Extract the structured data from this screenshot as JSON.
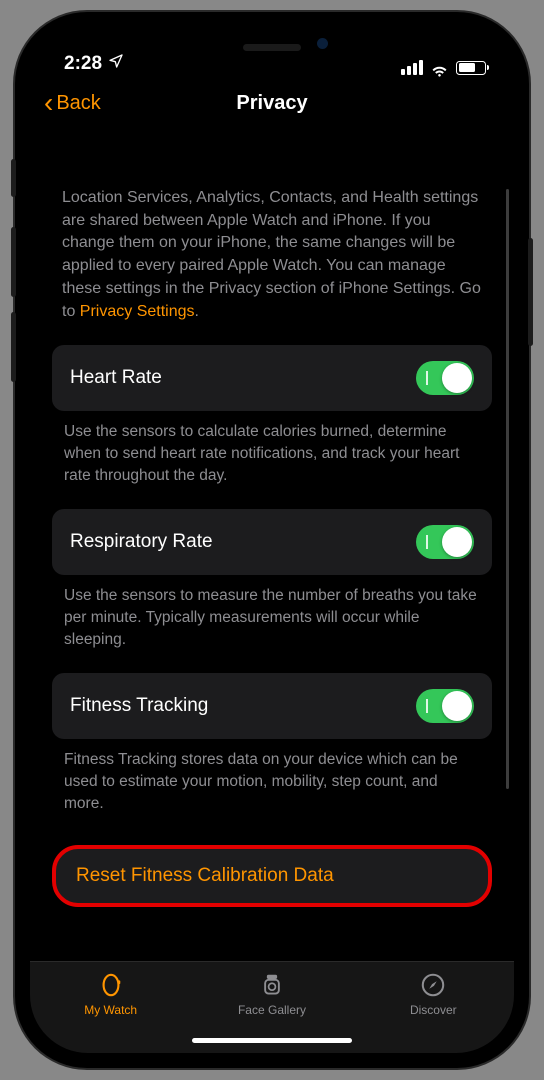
{
  "status": {
    "time": "2:28"
  },
  "nav": {
    "back": "Back",
    "title": "Privacy"
  },
  "intro": {
    "text": "Location Services, Analytics, Contacts, and Health settings are shared between Apple Watch and iPhone. If you change them on your iPhone, the same changes will be applied to every paired Apple Watch. You can manage these settings in the Privacy section of iPhone Settings. Go to ",
    "link": "Privacy Settings",
    "tail": "."
  },
  "rows": {
    "heart": {
      "label": "Heart Rate",
      "desc": "Use the sensors to calculate calories burned, determine when to send heart rate notifications, and track your heart rate throughout the day.",
      "on": true
    },
    "resp": {
      "label": "Respiratory Rate",
      "desc": "Use the sensors to measure the number of breaths you take per minute. Typically measurements will occur while sleeping.",
      "on": true
    },
    "fit": {
      "label": "Fitness Tracking",
      "desc": "Fitness Tracking stores data on your device which can be used to estimate your motion, mobility, step count, and more.",
      "on": true
    }
  },
  "reset": {
    "label": "Reset Fitness Calibration Data"
  },
  "tabs": {
    "watch": "My Watch",
    "gallery": "Face Gallery",
    "discover": "Discover"
  }
}
